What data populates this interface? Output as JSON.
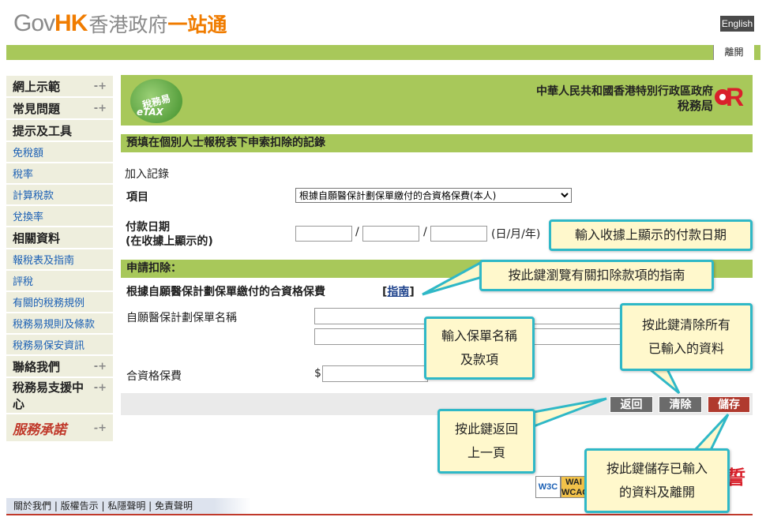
{
  "header": {
    "logo_gov": "Gov",
    "logo_hk": "HK",
    "logo_zh_grey": "香港政府",
    "logo_zh_orange": "一站通",
    "language_button": "English",
    "logout_label": "離開"
  },
  "sidebar": {
    "items": [
      {
        "label": "網上示範",
        "kind": "main"
      },
      {
        "label": "常見問題",
        "kind": "main"
      },
      {
        "label": "提示及工具",
        "kind": "head"
      },
      {
        "label": "免稅額",
        "kind": "sub"
      },
      {
        "label": "稅率",
        "kind": "sub"
      },
      {
        "label": "計算稅款",
        "kind": "sub"
      },
      {
        "label": "兌換率",
        "kind": "sub"
      },
      {
        "label": "相關資料",
        "kind": "head"
      },
      {
        "label": "報稅表及指南",
        "kind": "sub"
      },
      {
        "label": "評稅",
        "kind": "sub"
      },
      {
        "label": "有關的稅務規例",
        "kind": "sub"
      },
      {
        "label": "稅務易規則及條款",
        "kind": "sub"
      },
      {
        "label": "稅務易保安資訊",
        "kind": "sub"
      },
      {
        "label": "聯絡我們",
        "kind": "main"
      },
      {
        "label": "稅務易支援中心",
        "kind": "tall"
      },
      {
        "label": "服務承諾",
        "kind": "brand"
      }
    ],
    "arrow_glyph": "-+"
  },
  "banner": {
    "etax_zh": "稅務易",
    "etax_en": "eTAX",
    "gov_line": "中華人民共和國香港特別行政區政府",
    "dept_line": "稅務局"
  },
  "form": {
    "page_title": "預填在個別人士報稅表下申索扣除的記錄",
    "add_record": "加入記錄",
    "item_label": "項目",
    "item_selected": "根據自願醫保計劃保單繳付的合資格保費(本人)",
    "pay_date_label": "付款日期",
    "pay_date_sub": "(在收據上顯示的)",
    "date_format": "(日/月/年)",
    "claim_header": "申請扣除：",
    "claim_item": "根據自願醫保計劃保單繳付的合資格保費",
    "guide_link": "指南",
    "policy_name_label": "自願醫保計劃保單名稱",
    "premium_label": "合資格保費",
    "currency": "$",
    "back_button": "返回",
    "clear_button": "清除",
    "save_button": "儲存"
  },
  "callouts": {
    "date_tip": "輸入收據上顯示的付款日期",
    "guide_tip": "按此鍵瀏覽有關扣除款項的指南",
    "policy_tip": "輸入保單名稱\n及款項",
    "clear_tip": "按此鍵清除所有\n已輸入的資料",
    "back_tip": "按此鍵返回\n上一頁",
    "save_tip": "按此鍵儲存已輸入\n的資料及離開"
  },
  "footer": {
    "links_text": "關於我們 | 版權告示 | 私隱聲明 | 免責聲明",
    "w3c": "W3C",
    "wai": "WAI WCAG"
  },
  "colors": {
    "green_bar": "#a8c85a",
    "orange": "#f07c00",
    "callout_border": "#2fb8c7",
    "callout_fill": "#fff8cc",
    "save_red": "#b03a2e"
  }
}
